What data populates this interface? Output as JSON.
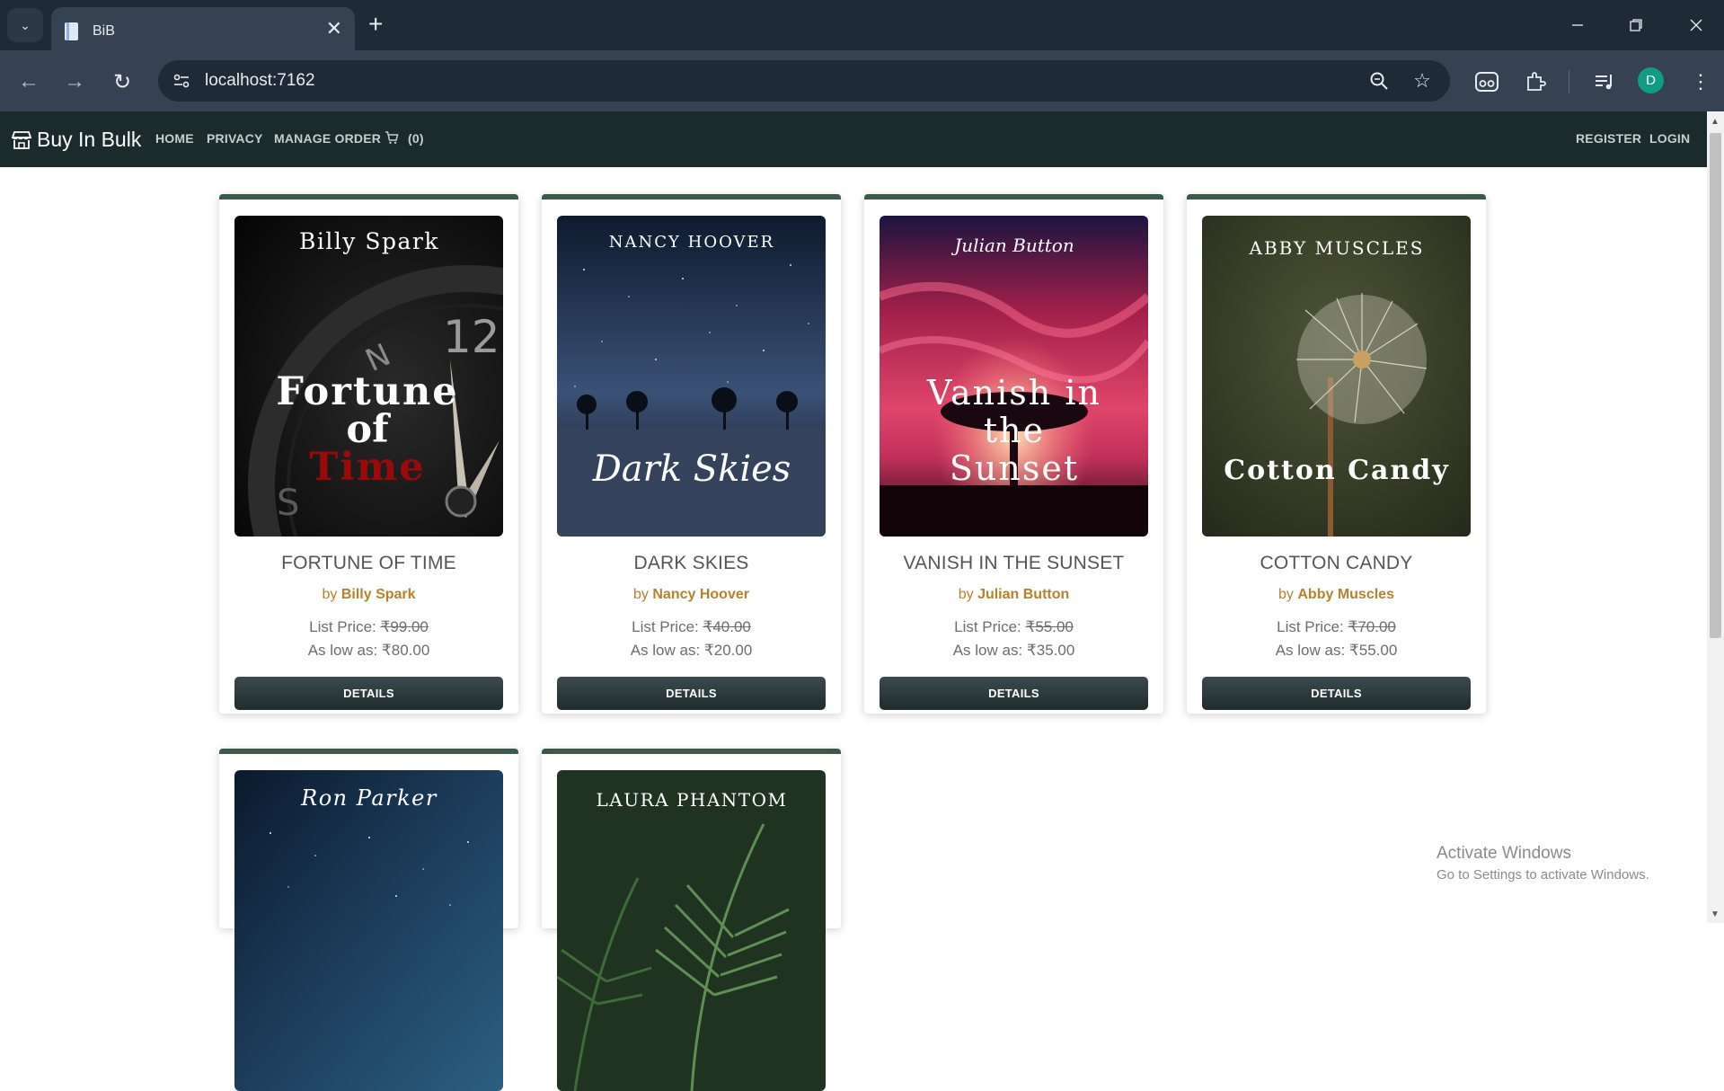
{
  "browser": {
    "tab_title": "BiB",
    "tab_close": "✕",
    "new_tab": "+",
    "url": "localhost:7162",
    "profile_initial": "D",
    "window_controls": [
      "minimize-icon",
      "restore-icon",
      "close-icon"
    ]
  },
  "site": {
    "brand": "Buy In Bulk",
    "nav": {
      "home": "HOME",
      "privacy": "PRIVACY",
      "manage_order": "MANAGE ORDER",
      "cart_count": "(0)",
      "register": "REGISTER",
      "login": "LOGIN"
    },
    "colors": {
      "navbar": "#1b2b2b",
      "card_top_border": "#3a5a4e",
      "author": "#b8802a",
      "button": "#263436"
    }
  },
  "products": [
    {
      "title": "FORTUNE OF TIME",
      "by": "by",
      "author": "Billy Spark",
      "list_label": "List Price:",
      "list_price": "₹99.00",
      "low_label": "As low as:",
      "low_price": "₹80.00",
      "button": "DETAILS",
      "cover": {
        "author": "Billy Spark",
        "title_lines": [
          "Fortune",
          "of",
          "Time"
        ],
        "theme": "clock"
      }
    },
    {
      "title": "DARK SKIES",
      "by": "by",
      "author": "Nancy Hoover",
      "list_label": "List Price:",
      "list_price": "₹40.00",
      "low_label": "As low as:",
      "low_price": "₹20.00",
      "button": "DETAILS",
      "cover": {
        "author": "NANCY HOOVER",
        "title_lines": [
          "Dark Skies"
        ],
        "theme": "night-field"
      }
    },
    {
      "title": "VANISH IN THE SUNSET",
      "by": "by",
      "author": "Julian Button",
      "list_label": "List Price:",
      "list_price": "₹55.00",
      "low_label": "As low as:",
      "low_price": "₹35.00",
      "button": "DETAILS",
      "cover": {
        "author": "Julian Button",
        "title_lines": [
          "Vanish in",
          "the",
          "Sunset"
        ],
        "theme": "sunset-tree"
      }
    },
    {
      "title": "COTTON CANDY",
      "by": "by",
      "author": "Abby Muscles",
      "list_label": "List Price:",
      "list_price": "₹70.00",
      "low_label": "As low as:",
      "low_price": "₹55.00",
      "button": "DETAILS",
      "cover": {
        "author": "ABBY MUSCLES",
        "title_lines": [
          "Cotton Candy"
        ],
        "theme": "dandelion"
      }
    },
    {
      "cover": {
        "author": "Ron Parker",
        "theme": "starry-sky"
      }
    },
    {
      "cover": {
        "author": "LAURA PHANTOM",
        "theme": "fern"
      }
    }
  ],
  "watermark": {
    "line1": "Activate Windows",
    "line2": "Go to Settings to activate Windows."
  }
}
